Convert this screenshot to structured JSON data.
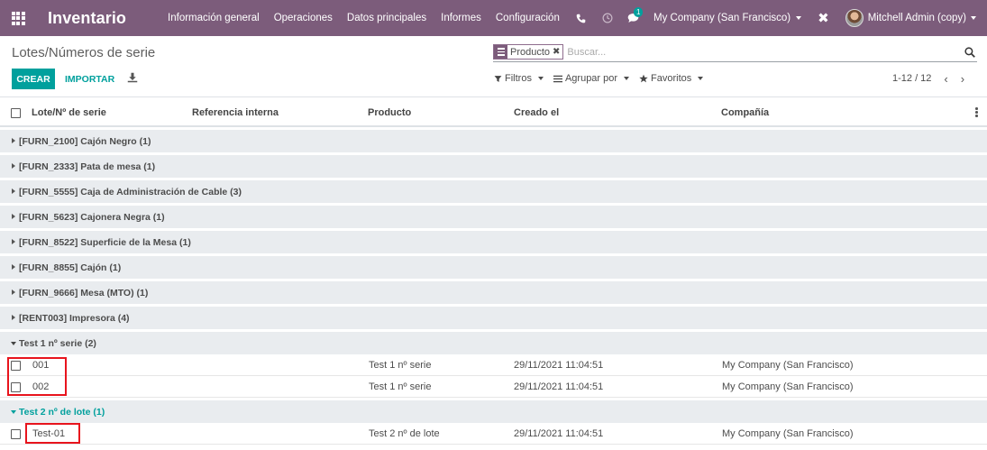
{
  "navbar": {
    "app_name": "Inventario",
    "menu": [
      "Información general",
      "Operaciones",
      "Datos principales",
      "Informes",
      "Configuración"
    ],
    "message_count": "1",
    "company": "My Company (San Francisco)",
    "user": "Mitchell Admin (copy)",
    "bg_color": "#7c5c7b"
  },
  "control": {
    "breadcrumb": "Lotes/Números de serie",
    "facet": "Producto",
    "search_placeholder": "Buscar...",
    "create_label": "CREAR",
    "import_label": "IMPORTAR",
    "filters_label": "Filtros",
    "groupby_label": "Agrupar por",
    "favorites_label": "Favoritos",
    "pager": "1-12 / 12",
    "accent_color": "#00a09d"
  },
  "list": {
    "columns": [
      "Lote/Nº de serie",
      "Referencia interna",
      "Producto",
      "Creado el",
      "Compañía"
    ],
    "groups": [
      {
        "label": "[FURN_2100] Cajón Negro (1)",
        "open": false,
        "rows": []
      },
      {
        "label": "[FURN_2333] Pata de mesa (1)",
        "open": false,
        "rows": []
      },
      {
        "label": "[FURN_5555] Caja de Administración de Cable (3)",
        "open": false,
        "rows": []
      },
      {
        "label": "[FURN_5623] Cajonera Negra (1)",
        "open": false,
        "rows": []
      },
      {
        "label": "[FURN_8522] Superficie de la Mesa (1)",
        "open": false,
        "rows": []
      },
      {
        "label": "[FURN_8855] Cajón (1)",
        "open": false,
        "rows": []
      },
      {
        "label": "[FURN_9666] Mesa (MTO) (1)",
        "open": false,
        "rows": []
      },
      {
        "label": "[RENT003] Impresora (4)",
        "open": false,
        "rows": []
      },
      {
        "label": "Test 1 nº serie (2)",
        "open": true,
        "rows": [
          {
            "lot": "001",
            "ref": "",
            "product": "Test 1 nº serie",
            "date": "29/11/2021 11:04:51",
            "company": "My Company (San Francisco)"
          },
          {
            "lot": "002",
            "ref": "",
            "product": "Test 1 nº serie",
            "date": "29/11/2021 11:04:51",
            "company": "My Company (San Francisco)"
          }
        ]
      },
      {
        "label": "Test 2 nº de lote (1)",
        "open": true,
        "rows": [
          {
            "lot": "Test-01",
            "ref": "",
            "product": "Test 2 nº de lote",
            "date": "29/11/2021 11:04:51",
            "company": "My Company (San Francisco)"
          }
        ]
      }
    ]
  }
}
